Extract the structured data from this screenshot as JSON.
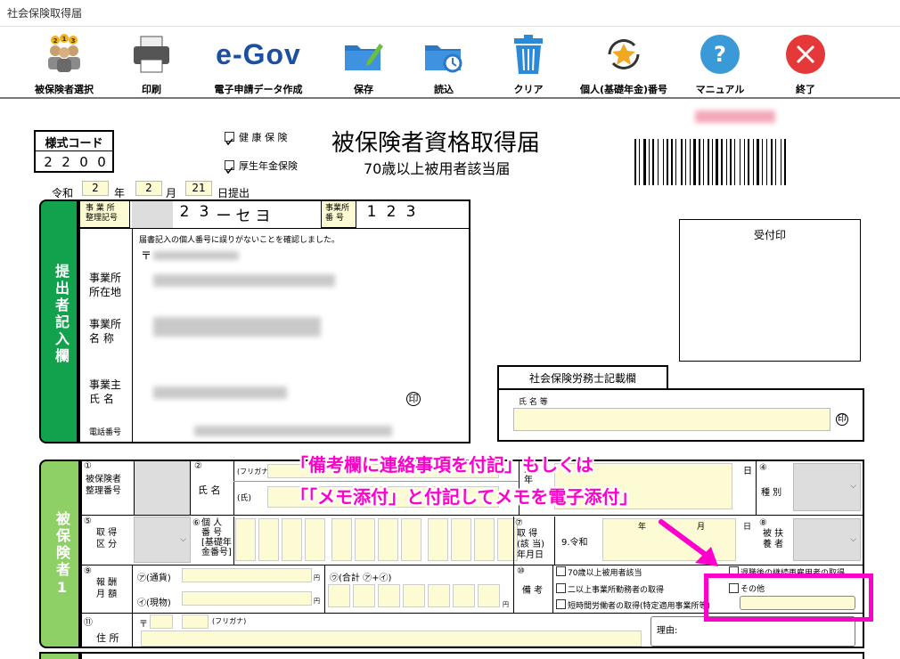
{
  "window": {
    "title": "社会保険取得届"
  },
  "toolbar": {
    "insured_select": "被保険者選択",
    "print": "印刷",
    "egov_logo": "e-Gov",
    "egov": "電子申請データ作成",
    "save": "保存",
    "load": "読込",
    "clear": "クリア",
    "personal_number": "個人(基礎年金)番号",
    "manual": "マニュアル",
    "exit": "終了"
  },
  "form": {
    "style_code_label": "様式コード",
    "style_code_digits": [
      "2",
      "2",
      "0",
      "0"
    ],
    "health_insurance": "健 康 保 険",
    "pension_insurance": "厚生年金保険",
    "title": "被保険者資格取得届",
    "subtitle": "70歳以上被用者該当届",
    "date": {
      "era": "令和",
      "year": "2",
      "year_unit": "年",
      "month": "2",
      "month_unit": "月",
      "day": "21",
      "day_unit": "日提出"
    },
    "office_ref_label": "事 業 所\n整理記号",
    "office_ref_chars": [
      "2",
      "3",
      "ー",
      "セ",
      "ヨ"
    ],
    "office_num_label": "事業所\n番 号",
    "office_num_chars": [
      "1",
      "2",
      "3"
    ],
    "submitter_section": "提出者記入欄",
    "confirm_note": "届書記入の個人番号に誤りがないことを確認しました。",
    "postal_mark": "〒",
    "address_label": "事業所\n所在地",
    "name_label": "事業所\n名 称",
    "owner_label": "事業主\n氏 名",
    "seal": "印",
    "phone_label": "電話番号",
    "receipt_label": "受付印",
    "sharoshi_label": "社会保険労務士記載欄",
    "sharoshi_name_label": "氏 名 等",
    "insured_section": "被保険者1",
    "n1": "①",
    "insured_number_label": "被保険者\n整理番号",
    "n2": "②",
    "name_field_label": "氏 名",
    "furigana": "(フリガナ)",
    "kanji_name": "(氏)",
    "birth_year": "生\n年",
    "day_char": "日",
    "n4": "④",
    "kind_label": "種 別",
    "n5": "⑤",
    "acq_type_label": "取 得\n区 分",
    "n6": "⑥",
    "personal_number_label": "個 人\n番 号\n[基礎年\n金番号]",
    "n7": "⑦",
    "acq_date_label": "取 得\n(該 当)\n年月日",
    "era_reiwa": "9.令和",
    "year_char": "年",
    "month_char": "月",
    "n8": "⑧",
    "dependent_label": "被 扶\n養 者",
    "n9": "⑨",
    "salary_label": "報 酬\n月 額",
    "currency_label": "㋐(通貨)",
    "goods_label": "㋑(現物)",
    "total_label": "㋒(合計 ㋐+㋑)",
    "yen": "円",
    "n10": "⑩",
    "remarks_label": "備 考",
    "remark_70": "70歳以上被用者該当",
    "remark_multi": "二以上事業所勤務者の取得",
    "remark_short": "短時間労働者の取得(特定適用事業所等)",
    "remark_retire": "退職後の継続再雇用者の取得",
    "remark_other": "その他",
    "n11": "⑪",
    "address_field_label": "住 所",
    "reason_label": "理由:"
  },
  "annotation": {
    "line1": "「備考欄に連絡事項を付記」もしくは",
    "line2": "「「メモ添付」と付記してメモを電子添付」",
    "color": "#ff00cc"
  }
}
